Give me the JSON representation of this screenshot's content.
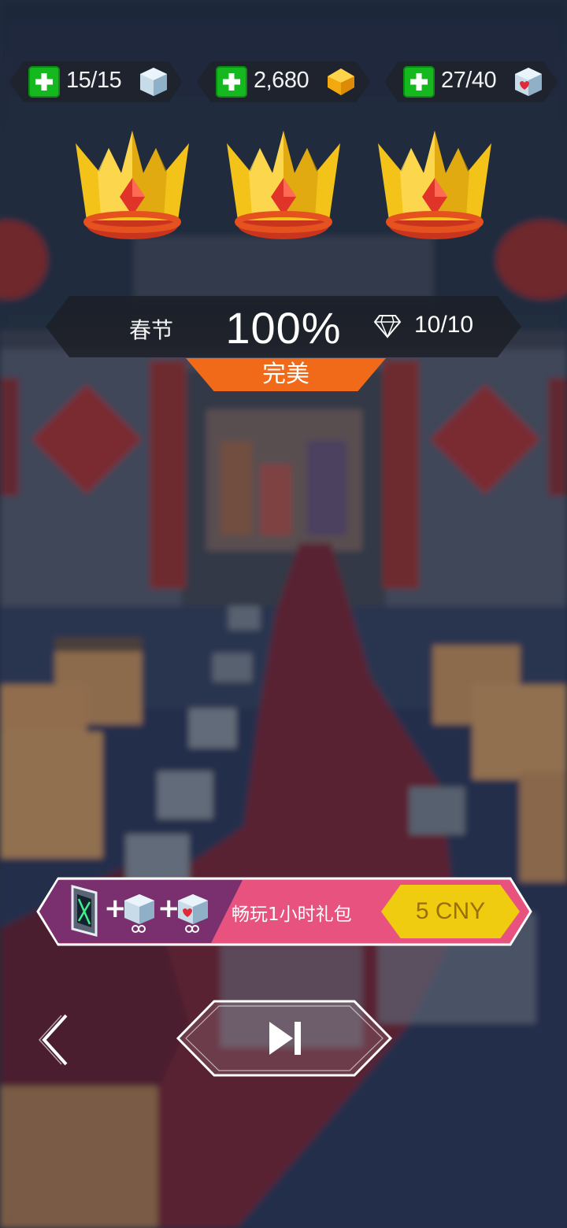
{
  "resources": [
    {
      "value": "15/15",
      "icon": "ice-cube-icon"
    },
    {
      "value": "2,680",
      "icon": "gold-gem-icon"
    },
    {
      "value": "27/40",
      "icon": "heart-cube-icon"
    }
  ],
  "crowns": {
    "earned": 3,
    "total": 3
  },
  "level": {
    "name": "春节",
    "percent": "100%",
    "gems": "10/10",
    "rating": "完美"
  },
  "offer": {
    "label": "畅玩1小时礼包",
    "price": "5 CNY"
  },
  "colors": {
    "accent_orange": "#f06a1a",
    "offer_pink": "#e8527f",
    "offer_purple": "#7a2f6e",
    "price_yellow": "#f0cc10",
    "plus_green": "#16b81f"
  }
}
